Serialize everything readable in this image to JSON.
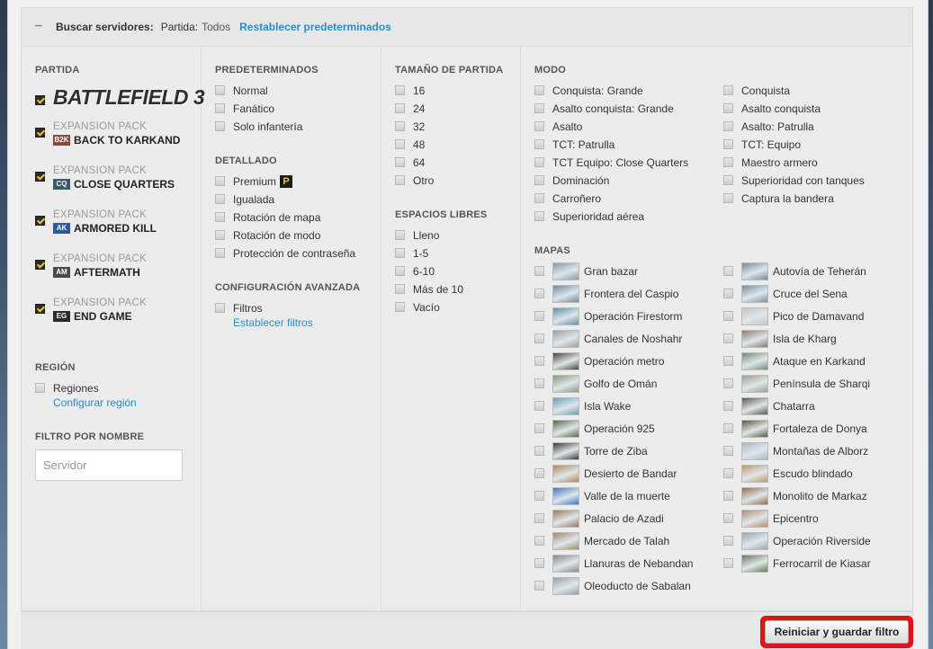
{
  "topbar": {
    "title": "Buscar servidores:",
    "partida_label": "Partida:",
    "partida_value": "Todos",
    "reset_defaults": "Restablecer predeterminados"
  },
  "partida": {
    "heading": "PARTIDA",
    "base_game": "BATTLEFIELD 3",
    "expansions": [
      {
        "pack": "EXPANSION PACK",
        "badge": "B2K",
        "name": "BACK TO KARKAND",
        "color": "#8a4a3a"
      },
      {
        "pack": "EXPANSION PACK",
        "badge": "CQ",
        "name": "CLOSE QUARTERS",
        "color": "#3a5a6a"
      },
      {
        "pack": "EXPANSION PACK",
        "badge": "AK",
        "name": "ARMORED KILL",
        "color": "#2c5a9a"
      },
      {
        "pack": "EXPANSION PACK",
        "badge": "AM",
        "name": "AFTERMATH",
        "color": "#4a4a4a"
      },
      {
        "pack": "EXPANSION PACK",
        "badge": "EG",
        "name": "END GAME",
        "color": "#2a2a2a"
      }
    ]
  },
  "region": {
    "heading": "REGIÓN",
    "label": "Regiones",
    "configure": "Configurar región"
  },
  "name_filter": {
    "heading": "FILTRO POR NOMBRE",
    "placeholder": "Servidor"
  },
  "presets": {
    "heading": "PREDETERMINADOS",
    "items": [
      "Normal",
      "Fanático",
      "Solo infantería"
    ]
  },
  "detailed": {
    "heading": "DETALLADO",
    "items": [
      "Premium",
      "Igualada",
      "Rotación de mapa",
      "Rotación de modo",
      "Protección de contraseña"
    ]
  },
  "advanced": {
    "heading": "CONFIGURACIÓN AVANZADA",
    "label": "Filtros",
    "link": "Establecer filtros"
  },
  "game_size": {
    "heading": "TAMAÑO DE PARTIDA",
    "items": [
      "16",
      "24",
      "32",
      "48",
      "64",
      "Otro"
    ]
  },
  "free_slots": {
    "heading": "ESPACIOS LIBRES",
    "items": [
      "Lleno",
      "1-5",
      "6-10",
      "Más de 10",
      "Vacío"
    ]
  },
  "modes": {
    "heading": "MODO",
    "left": [
      "Conquista: Grande",
      "Asalto conquista: Grande",
      "Asalto",
      "TCT: Patrulla",
      "TCT Equipo: Close Quarters",
      "Dominación",
      "Carroñero",
      "Superioridad aérea"
    ],
    "right": [
      "Conquista",
      "Asalto conquista",
      "Asalto: Patrulla",
      "TCT: Equipo",
      "Maestro armero",
      "Superioridad con tanques",
      "Captura la bandera"
    ]
  },
  "maps": {
    "heading": "MAPAS",
    "left": [
      "Gran bazar",
      "Frontera del Caspio",
      "Operación Firestorm",
      "Canales de Noshahr",
      "Operación metro",
      "Golfo de Omán",
      "Isla Wake",
      "Operación 925",
      "Torre de Ziba",
      "Desierto de Bandar",
      "Valle de la muerte",
      "Palacio de Azadi",
      "Mercado de Talah",
      "Llanuras de Nebandan",
      "Oleoducto de Sabalan"
    ],
    "right": [
      "Autovía de Teherán",
      "Cruce del Sena",
      "Pico de Damavand",
      "Isla de Kharg",
      "Ataque en Karkand",
      "Península de Sharqi",
      "Chatarra",
      "Fortaleza de Donya",
      "Montañas de Alborz",
      "Escudo blindado",
      "Monolito de Markaz",
      "Epicentro",
      "Operación Riverside",
      "Ferrocarril de Kiasar"
    ],
    "thumb_colors_left": [
      "#8a9ba8",
      "#6f8aa0",
      "#5f8fae",
      "#9fa0a0",
      "#4a4a3a",
      "#8a9a7a",
      "#6aa0b8",
      "#5a6a4a",
      "#3a3a3a",
      "#b08a5a",
      "#3a7ac0",
      "#9a7a5a",
      "#a08a6a",
      "#8a8a8a",
      "#9aa0a8"
    ],
    "thumb_colors_right": [
      "#7a8a9a",
      "#7a90a8",
      "#c0c8d0",
      "#8a7a6a",
      "#7a8a7a",
      "#9aa090",
      "#5a5a4a",
      "#5a5a3a",
      "#a8b8c8",
      "#c09a6a",
      "#9a6a4a",
      "#b09070",
      "#9aa8b0",
      "#6a7a5a"
    ]
  },
  "save_button": "Reiniciar y guardar filtro"
}
